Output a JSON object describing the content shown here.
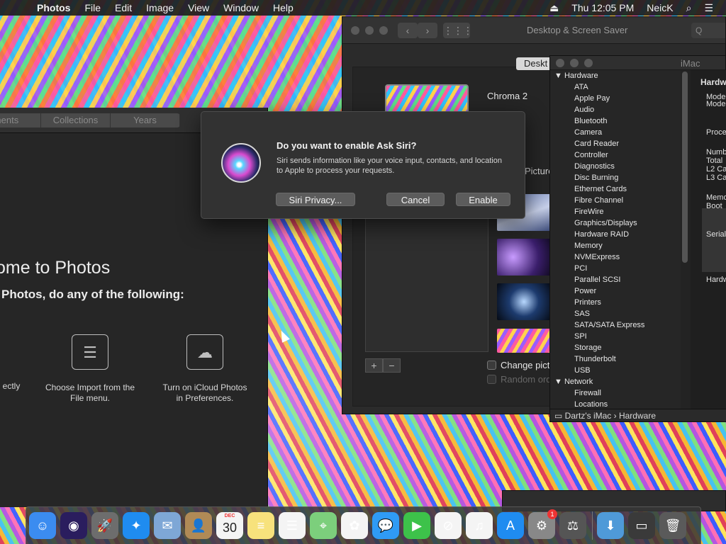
{
  "menubar": {
    "app_name": "Photos",
    "items": [
      "File",
      "Edit",
      "Image",
      "View",
      "Window",
      "Help"
    ],
    "clock": "Thu 12:05 PM",
    "user": "NeicK"
  },
  "photos": {
    "tabs": [
      "ments",
      "Collections",
      "Years"
    ],
    "welcome_title": "ome to Photos",
    "welcome_sub": "Photos, do any of the following:",
    "col1": "ectly",
    "col2_line1": "Choose Import from the",
    "col2_line2": "File menu.",
    "col3_line1": "Turn on iCloud Photos",
    "col3_line2": "in Preferences."
  },
  "prefs": {
    "title": "Desktop & Screen Saver",
    "search_placeholder": "Q",
    "tab_desktop": "Deskt",
    "current_picture": "Chroma 2",
    "pictures_label": "Picture",
    "change_picture": "Change pict",
    "random_order": "Random ord"
  },
  "siri": {
    "title": "Do you want to enable Ask Siri?",
    "body": "Siri sends information like your voice input, contacts, and location to Apple to process your requests.",
    "privacy_btn": "Siri Privacy...",
    "cancel_btn": "Cancel",
    "enable_btn": "Enable"
  },
  "sysinfo": {
    "title": "iMac",
    "tree": [
      {
        "label": "▼ Hardware",
        "type": "cat"
      },
      {
        "label": "ATA",
        "type": "sub"
      },
      {
        "label": "Apple Pay",
        "type": "sub"
      },
      {
        "label": "Audio",
        "type": "sub"
      },
      {
        "label": "Bluetooth",
        "type": "sub"
      },
      {
        "label": "Camera",
        "type": "sub"
      },
      {
        "label": "Card Reader",
        "type": "sub"
      },
      {
        "label": "Controller",
        "type": "sub"
      },
      {
        "label": "Diagnostics",
        "type": "sub"
      },
      {
        "label": "Disc Burning",
        "type": "sub"
      },
      {
        "label": "Ethernet Cards",
        "type": "sub"
      },
      {
        "label": "Fibre Channel",
        "type": "sub"
      },
      {
        "label": "FireWire",
        "type": "sub"
      },
      {
        "label": "Graphics/Displays",
        "type": "sub"
      },
      {
        "label": "Hardware RAID",
        "type": "sub"
      },
      {
        "label": "Memory",
        "type": "sub"
      },
      {
        "label": "NVMExpress",
        "type": "sub"
      },
      {
        "label": "PCI",
        "type": "sub"
      },
      {
        "label": "Parallel SCSI",
        "type": "sub"
      },
      {
        "label": "Power",
        "type": "sub"
      },
      {
        "label": "Printers",
        "type": "sub"
      },
      {
        "label": "SAS",
        "type": "sub"
      },
      {
        "label": "SATA/SATA Express",
        "type": "sub"
      },
      {
        "label": "SPI",
        "type": "sub"
      },
      {
        "label": "Storage",
        "type": "sub"
      },
      {
        "label": "Thunderbolt",
        "type": "sub"
      },
      {
        "label": "USB",
        "type": "sub"
      },
      {
        "label": "▼ Network",
        "type": "cat"
      },
      {
        "label": "Firewall",
        "type": "sub"
      },
      {
        "label": "Locations",
        "type": "sub"
      }
    ],
    "detail_heading": "Hardw",
    "detail_lines": [
      "Mode",
      "Mode",
      "Proce",
      "Numb",
      "Total",
      "L2 Ca",
      "L3 Ca",
      "Memo",
      "Boot",
      "Serial",
      "Hardw"
    ],
    "path": "Dartz's iMac › Hardware"
  },
  "dock": {
    "calendar_month": "DEC",
    "calendar_day": "30",
    "badge_count": "1",
    "apps": [
      {
        "name": "finder-icon",
        "color": "#3b8cf0",
        "glyph": "☺"
      },
      {
        "name": "siri-icon",
        "color": "#2a1d5e",
        "glyph": "◉"
      },
      {
        "name": "launchpad-icon",
        "color": "#6d6d6d",
        "glyph": "🚀"
      },
      {
        "name": "safari-icon",
        "color": "#1f8cf0",
        "glyph": "✦"
      },
      {
        "name": "mail-icon",
        "color": "#7ea7d6",
        "glyph": "✉"
      },
      {
        "name": "contacts-icon",
        "color": "#b08a56",
        "glyph": "👤"
      },
      {
        "name": "calendar-icon",
        "color": "#f4f4f4",
        "glyph": ""
      },
      {
        "name": "notes-icon",
        "color": "#f7e27c",
        "glyph": "≡"
      },
      {
        "name": "reminders-icon",
        "color": "#f4f4f4",
        "glyph": "☰"
      },
      {
        "name": "maps-icon",
        "color": "#7ccf7c",
        "glyph": "⌖"
      },
      {
        "name": "photos-icon",
        "color": "#f4f4f4",
        "glyph": "✿"
      },
      {
        "name": "messages-icon",
        "color": "#2f9bf5",
        "glyph": "💬"
      },
      {
        "name": "facetime-icon",
        "color": "#3dc24a",
        "glyph": "▶"
      },
      {
        "name": "news-icon",
        "color": "#f4f4f4",
        "glyph": "⊘"
      },
      {
        "name": "music-icon",
        "color": "#f4f4f4",
        "glyph": "♫"
      },
      {
        "name": "app-store-icon",
        "color": "#1f8cf0",
        "glyph": "A"
      },
      {
        "name": "system-preferences-icon",
        "color": "#888",
        "glyph": "⚙"
      },
      {
        "name": "system-information-icon",
        "color": "#555",
        "glyph": "⚖"
      }
    ],
    "trailing": [
      {
        "name": "downloads-folder-icon",
        "color": "#4f9ad8",
        "glyph": "⬇"
      },
      {
        "name": "system-info-window-icon",
        "color": "#3a3a3a",
        "glyph": "▭"
      },
      {
        "name": "trash-icon",
        "color": "#5a5a5a",
        "glyph": "🗑"
      }
    ]
  }
}
